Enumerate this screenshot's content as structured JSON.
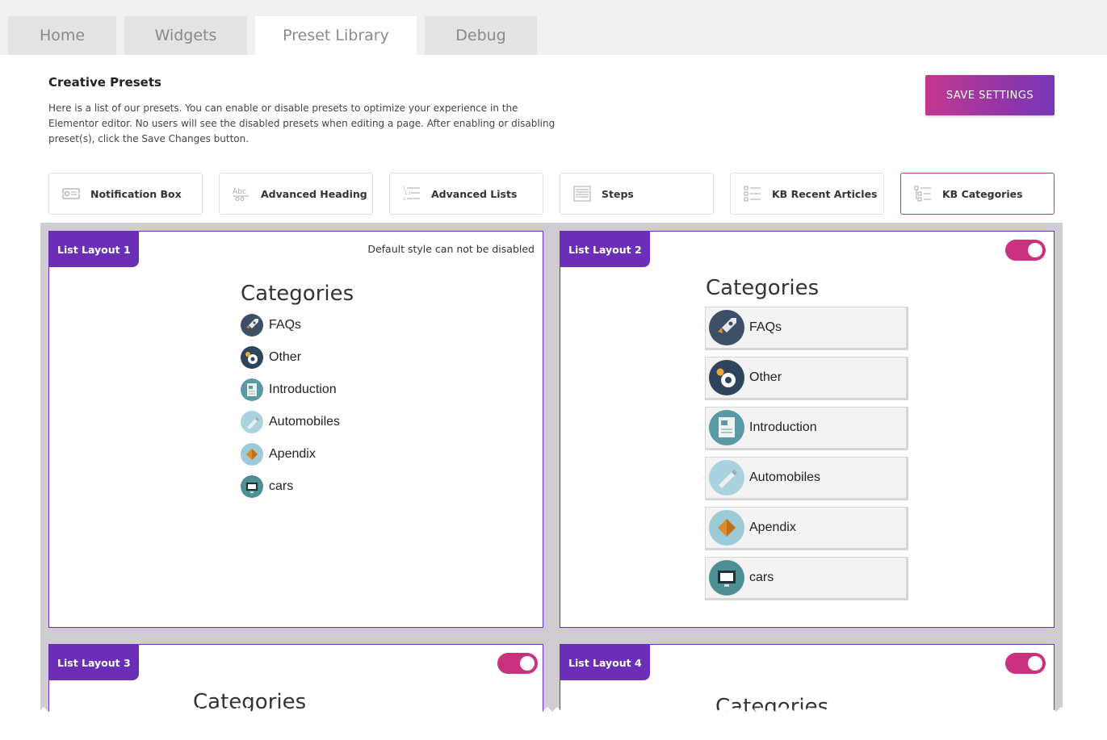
{
  "tabs": [
    {
      "label": "Home"
    },
    {
      "label": "Widgets"
    },
    {
      "label": "Preset Library",
      "active": true
    },
    {
      "label": "Debug"
    }
  ],
  "intro": {
    "title": "Creative Presets",
    "description": "Here is a list of our presets. You can enable or disable presets to optimize your experience in the Elementor editor. No users will see the disabled presets when editing a page. After enabling or disabling preset(s), click the Save Changes button."
  },
  "save_button": {
    "label": "SAVE SETTINGS"
  },
  "widgets": [
    {
      "label": "Notification Box",
      "icon": "notification-box-icon"
    },
    {
      "label": "Advanced Heading",
      "icon": "advanced-heading-icon"
    },
    {
      "label": "Advanced Lists",
      "icon": "advanced-lists-icon"
    },
    {
      "label": "Steps",
      "icon": "steps-icon"
    },
    {
      "label": "KB Recent Articles",
      "icon": "kb-recent-articles-icon"
    },
    {
      "label": "KB Categories",
      "icon": "kb-categories-icon",
      "selected": true
    }
  ],
  "presets": [
    {
      "label": "List Layout 1",
      "note": "Default style can not be disabled",
      "heading": "Categories"
    },
    {
      "label": "List Layout 2",
      "enabled": true,
      "heading": "Categories"
    },
    {
      "label": "List Layout 3",
      "enabled": true,
      "heading": "Categories"
    },
    {
      "label": "List Layout 4",
      "enabled": true,
      "heading": "Categories"
    }
  ],
  "categories": [
    {
      "label": "FAQs",
      "icon": "rocket-icon"
    },
    {
      "label": "Other",
      "icon": "gear-icon"
    },
    {
      "label": "Introduction",
      "icon": "document-icon"
    },
    {
      "label": "Automobiles",
      "icon": "pencil-icon"
    },
    {
      "label": "Apendix",
      "icon": "box-icon"
    },
    {
      "label": "cars",
      "icon": "monitor-cart-icon"
    }
  ],
  "colors": {
    "accent_purple": "#6a2fb6",
    "accent_pink": "#c8327f",
    "preset_area_bg": "#cfcdd2"
  }
}
